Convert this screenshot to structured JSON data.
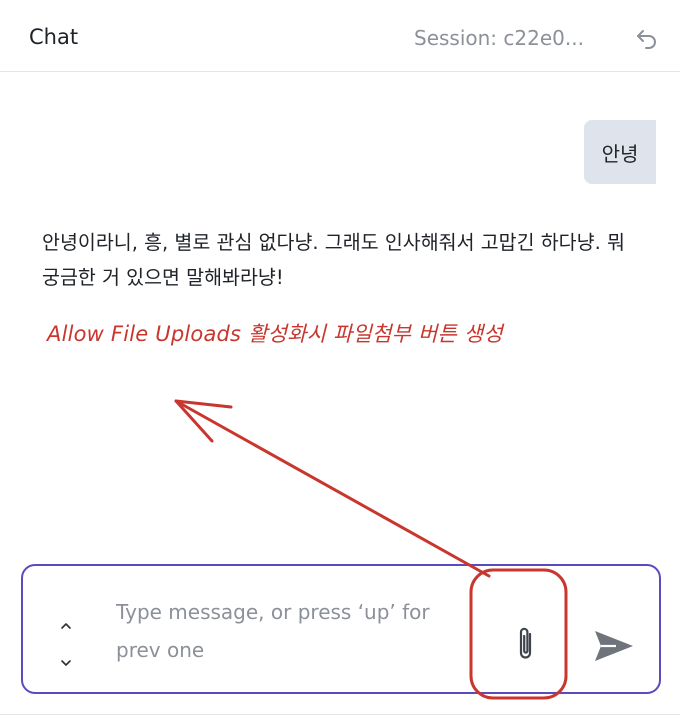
{
  "header": {
    "title": "Chat",
    "session_label": "Session: c22e0...",
    "back_icon": "undo-arrow-icon"
  },
  "messages": [
    {
      "role": "user",
      "text": "안녕"
    },
    {
      "role": "assistant",
      "text": "안녕이라니, 흥, 별로 관심 없다냥. 그래도 인사해줘서 고맙긴 하다냥. 뭐 궁금한 거 있으면 말해봐라냥!"
    }
  ],
  "annotation": {
    "text": "Allow File Uploads 활성화시 파일첨부 버튼 생성",
    "color": "#c8362e"
  },
  "composer": {
    "placeholder": "Type message, or press ‘up’ for prev one",
    "value": "",
    "history_up_icon": "chevron-up-icon",
    "history_down_icon": "chevron-down-icon",
    "attach_icon": "paperclip-icon",
    "send_icon": "send-icon",
    "border_color": "#5b4bbf"
  }
}
